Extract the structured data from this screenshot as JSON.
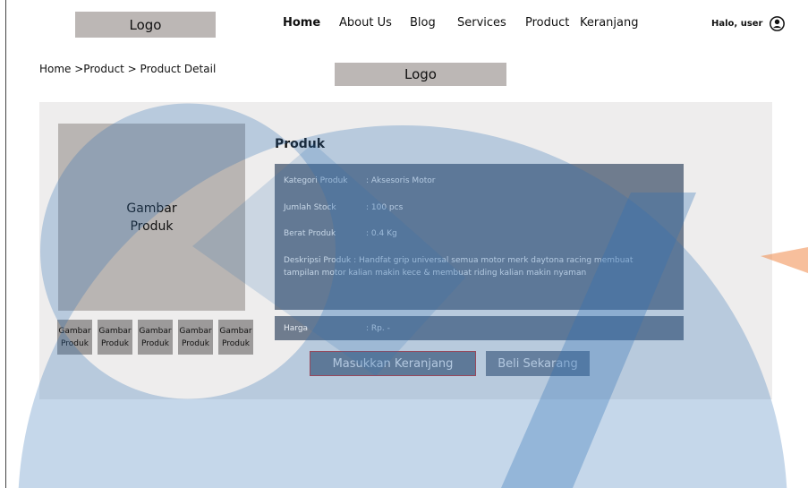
{
  "header": {
    "logo": "Logo",
    "nav": [
      "Home",
      "About Us",
      "Blog",
      "Services",
      "Product",
      "Keranjang"
    ],
    "greeting": "Halo, user"
  },
  "breadcrumb": "Home >Product >  Product Detail",
  "center_logo": "Logo",
  "product": {
    "image_label_line1": "Gambar",
    "image_label_line2": "Produk",
    "thumbnails": [
      "Gambar Produk",
      "Gambar Produk",
      "Gambar Produk",
      "Gambar Produk",
      "Gambar Produk"
    ],
    "title": "Produk",
    "category_label": "Kategori Produk",
    "category_value": ": Aksesoris Motor",
    "stock_label": "Jumlah Stock",
    "stock_value": ": 100 pcs",
    "weight_label": "Berat Produk",
    "weight_value": ": 0.4 Kg",
    "description": "Deskripsi Produk   : Handfat grip universal semua motor merk daytona racing membuat tampilan motor kalian makin kece & membuat riding kalian makin nyaman",
    "price_label": "Harga",
    "price_value": ": Rp. -"
  },
  "buttons": {
    "add_to_cart": "Masukkan Keranjang",
    "buy_now": "Beli Sekarang"
  },
  "colors": {
    "overlay_blue": "#2e6fb4",
    "overlay_orange": "#f08a4b",
    "panel_bg": "#eeeded"
  }
}
